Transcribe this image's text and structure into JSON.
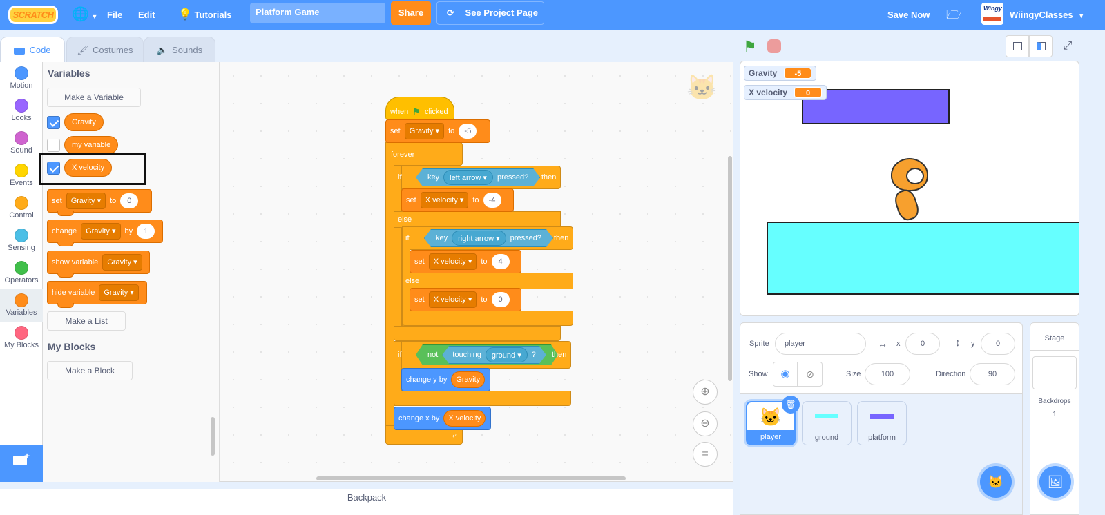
{
  "menubar": {
    "logo": "SCRATCH",
    "file": "File",
    "edit": "Edit",
    "tutorials": "Tutorials",
    "project_title": "Platform Game",
    "share": "Share",
    "see_project_page": "See Project Page",
    "save_now": "Save Now",
    "username": "WiingyClasses",
    "avatar_text": "Wingy"
  },
  "tabs": [
    {
      "label": "Code",
      "active": true
    },
    {
      "label": "Costumes",
      "active": false
    },
    {
      "label": "Sounds",
      "active": false
    }
  ],
  "categories": [
    {
      "label": "Motion",
      "color": "#4c97ff"
    },
    {
      "label": "Looks",
      "color": "#9966ff"
    },
    {
      "label": "Sound",
      "color": "#cf63cf"
    },
    {
      "label": "Events",
      "color": "#ffd500"
    },
    {
      "label": "Control",
      "color": "#ffab19"
    },
    {
      "label": "Sensing",
      "color": "#4cbfe6"
    },
    {
      "label": "Operators",
      "color": "#40bf4a"
    },
    {
      "label": "Variables",
      "color": "#ff8c1a"
    },
    {
      "label": "My Blocks",
      "color": "#ff6680"
    }
  ],
  "palette": {
    "variables_heading": "Variables",
    "make_variable": "Make a Variable",
    "variables": [
      {
        "name": "Gravity",
        "checked": true
      },
      {
        "name": "my variable",
        "checked": false
      },
      {
        "name": "X velocity",
        "checked": true
      }
    ],
    "set_block": {
      "label": "set",
      "var": "Gravity",
      "to": "to",
      "value": "0"
    },
    "change_block": {
      "label": "change",
      "var": "Gravity",
      "by": "by",
      "value": "1"
    },
    "show_block": {
      "label": "show variable",
      "var": "Gravity"
    },
    "hide_block": {
      "label": "hide variable",
      "var": "Gravity"
    },
    "make_list": "Make a List",
    "my_blocks_heading": "My Blocks",
    "make_block": "Make a Block"
  },
  "script": {
    "hat": {
      "when": "when",
      "clicked": "clicked"
    },
    "set_gravity": {
      "label": "set",
      "var": "Gravity",
      "to": "to",
      "value": "-5"
    },
    "forever": "forever",
    "if1": {
      "if": "if",
      "key": "key",
      "key_name": "left arrow",
      "pressed": "pressed?",
      "then": "then"
    },
    "set_xv_left": {
      "label": "set",
      "var": "X velocity",
      "to": "to",
      "value": "-4"
    },
    "else1": "else",
    "if2": {
      "if": "if",
      "key": "key",
      "key_name": "right arrow",
      "pressed": "pressed?",
      "then": "then"
    },
    "set_xv_right": {
      "label": "set",
      "var": "X velocity",
      "to": "to",
      "value": "4"
    },
    "else2": "else",
    "set_xv_zero": {
      "label": "set",
      "var": "X velocity",
      "to": "to",
      "value": "0"
    },
    "if3": {
      "if": "if",
      "not": "not",
      "touching": "touching",
      "target": "ground",
      "q": "?",
      "then": "then"
    },
    "change_y": {
      "label": "change y by",
      "var": "Gravity"
    },
    "change_x": {
      "label": "change x by",
      "var": "X velocity"
    }
  },
  "backpack": "Backpack",
  "stage": {
    "monitors": [
      {
        "name": "Gravity",
        "value": "-5"
      },
      {
        "name": "X velocity",
        "value": "0"
      }
    ],
    "platform_color": "#7765ff",
    "ground_color": "#66ffff"
  },
  "sprite_info": {
    "sprite_label": "Sprite",
    "sprite_name": "player",
    "x_label": "x",
    "x": "0",
    "y_label": "y",
    "y": "0",
    "show_label": "Show",
    "size_label": "Size",
    "size": "100",
    "direction_label": "Direction",
    "direction": "90"
  },
  "sprites": [
    {
      "name": "player",
      "selected": true
    },
    {
      "name": "ground",
      "selected": false
    },
    {
      "name": "platform",
      "selected": false
    }
  ],
  "stage_pane": {
    "title": "Stage",
    "backdrops_label": "Backdrops",
    "backdrops_count": "1"
  }
}
